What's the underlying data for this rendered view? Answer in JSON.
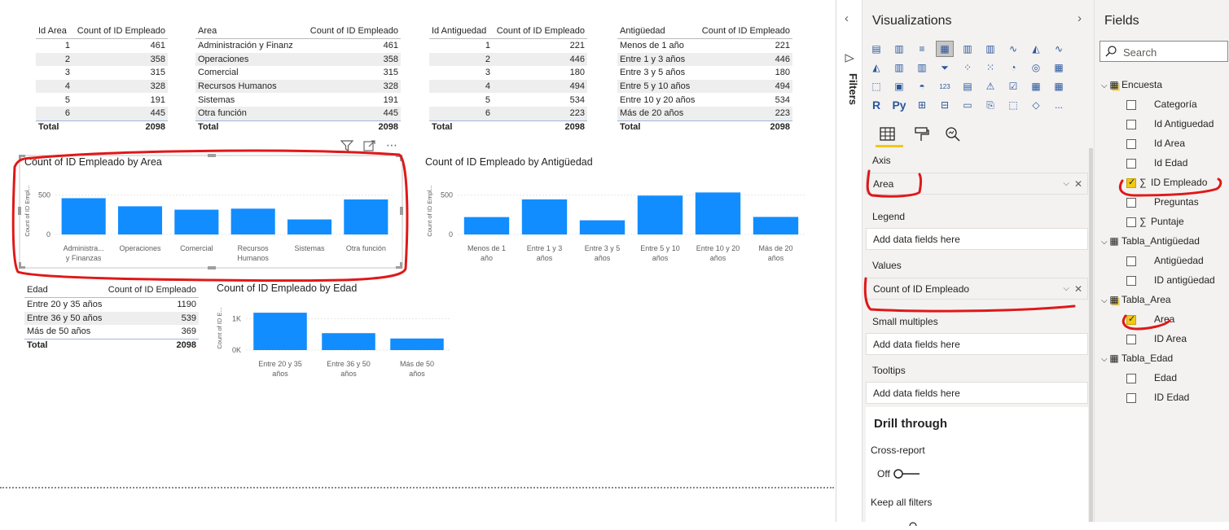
{
  "tables": {
    "area_id": {
      "headers": [
        "Id Area",
        "Count of ID Empleado"
      ],
      "rows": [
        [
          "1",
          "461"
        ],
        [
          "2",
          "358"
        ],
        [
          "3",
          "315"
        ],
        [
          "4",
          "328"
        ],
        [
          "5",
          "191"
        ],
        [
          "6",
          "445"
        ]
      ],
      "total": [
        "Total",
        "2098"
      ]
    },
    "area": {
      "headers": [
        "Area",
        "Count of ID Empleado"
      ],
      "rows": [
        [
          "Administración y Finanzas",
          "461"
        ],
        [
          "Operaciones",
          "358"
        ],
        [
          "Comercial",
          "315"
        ],
        [
          "Recursos Humanos",
          "328"
        ],
        [
          "Sistemas",
          "191"
        ],
        [
          "Otra función",
          "445"
        ]
      ],
      "total": [
        "Total",
        "2098"
      ]
    },
    "antig_id": {
      "headers": [
        "Id Antiguedad",
        "Count of ID Empleado"
      ],
      "rows": [
        [
          "1",
          "221"
        ],
        [
          "2",
          "446"
        ],
        [
          "3",
          "180"
        ],
        [
          "4",
          "494"
        ],
        [
          "5",
          "534"
        ],
        [
          "6",
          "223"
        ]
      ],
      "total": [
        "Total",
        "2098"
      ]
    },
    "antig": {
      "headers": [
        "Antigüedad",
        "Count of ID Empleado"
      ],
      "rows": [
        [
          "Menos de 1 año",
          "221"
        ],
        [
          "Entre 1 y 3 años",
          "446"
        ],
        [
          "Entre 3 y 5 años",
          "180"
        ],
        [
          "Entre 5 y 10 años",
          "494"
        ],
        [
          "Entre 10 y 20 años",
          "534"
        ],
        [
          "Más de 20 años",
          "223"
        ]
      ],
      "total": [
        "Total",
        "2098"
      ]
    },
    "edad": {
      "headers": [
        "Edad",
        "Count of ID Empleado"
      ],
      "rows": [
        [
          "Entre 20 y 35 años",
          "1190"
        ],
        [
          "Entre 36 y 50 años",
          "539"
        ],
        [
          "Más de 50 años",
          "369"
        ]
      ],
      "total": [
        "Total",
        "2098"
      ]
    }
  },
  "chart_data": [
    {
      "type": "bar",
      "title": "Count of ID Empleado by Area",
      "ylabel": "Count of ID Empl...",
      "yticks": [
        "500",
        "0"
      ],
      "ylim": [
        0,
        600
      ],
      "categories": [
        [
          "Administra...",
          "y Finanzas"
        ],
        [
          "Operaciones"
        ],
        [
          "Comercial"
        ],
        [
          "Recursos",
          "Humanos"
        ],
        [
          "Sistemas"
        ],
        [
          "Otra función"
        ]
      ],
      "values": [
        461,
        358,
        315,
        328,
        191,
        445
      ],
      "color": "#118dff"
    },
    {
      "type": "bar",
      "title": "Count of ID Empleado by Antigüedad",
      "ylabel": "Count of ID Empl...",
      "yticks": [
        "500",
        "0"
      ],
      "ylim": [
        0,
        600
      ],
      "categories": [
        [
          "Menos de 1",
          "año"
        ],
        [
          "Entre 1 y 3",
          "años"
        ],
        [
          "Entre 3 y 5",
          "años"
        ],
        [
          "Entre 5 y 10",
          "años"
        ],
        [
          "Entre 10 y 20",
          "años"
        ],
        [
          "Más de 20",
          "años"
        ]
      ],
      "values": [
        221,
        446,
        180,
        494,
        534,
        223
      ],
      "color": "#118dff"
    },
    {
      "type": "bar",
      "title": "Count of ID Empleado by Edad",
      "ylabel": "Count of ID E...",
      "yticks": [
        "1K",
        "0K"
      ],
      "ylim": [
        0,
        1400
      ],
      "categories": [
        [
          "Entre 20 y 35",
          "años"
        ],
        [
          "Entre 36 y 50",
          "años"
        ],
        [
          "Más de 50",
          "años"
        ]
      ],
      "values": [
        1190,
        539,
        369
      ],
      "color": "#118dff"
    }
  ],
  "filters_pane": {
    "label": "Filters"
  },
  "visualizations": {
    "title": "Visualizations",
    "wells": {
      "axis": {
        "label": "Axis",
        "value": "Area"
      },
      "legend": {
        "label": "Legend",
        "placeholder": "Add data fields here"
      },
      "values": {
        "label": "Values",
        "value": "Count of ID Empleado"
      },
      "small_multiples": {
        "label": "Small multiples",
        "placeholder": "Add data fields here"
      },
      "tooltips": {
        "label": "Tooltips",
        "placeholder": "Add data fields here"
      }
    },
    "drill_through": {
      "title": "Drill through",
      "cross_report": "Cross-report",
      "toggle": "Off",
      "keep_filters": "Keep all filters"
    },
    "more": "..."
  },
  "fields": {
    "title": "Fields",
    "search_placeholder": "Search",
    "tables": [
      {
        "name": "Encuesta",
        "items": [
          {
            "label": "Categoría",
            "checked": false,
            "sigma": false
          },
          {
            "label": "Id Antiguedad",
            "checked": false,
            "sigma": false
          },
          {
            "label": "Id Area",
            "checked": false,
            "sigma": false
          },
          {
            "label": "Id Edad",
            "checked": false,
            "sigma": false
          },
          {
            "label": "ID Empleado",
            "checked": true,
            "sigma": true
          },
          {
            "label": "Preguntas",
            "checked": false,
            "sigma": false
          },
          {
            "label": "Puntaje",
            "checked": false,
            "sigma": true
          }
        ]
      },
      {
        "name": "Tabla_Antigüedad",
        "items": [
          {
            "label": "Antigüedad",
            "checked": false,
            "sigma": false
          },
          {
            "label": "ID antigüedad",
            "checked": false,
            "sigma": false
          }
        ]
      },
      {
        "name": "Tabla_Area",
        "items": [
          {
            "label": "Area",
            "checked": true,
            "sigma": false
          },
          {
            "label": "ID Area",
            "checked": false,
            "sigma": false
          }
        ]
      },
      {
        "name": "Tabla_Edad",
        "items": [
          {
            "label": "Edad",
            "checked": false,
            "sigma": false
          },
          {
            "label": "ID Edad",
            "checked": false,
            "sigma": false
          }
        ]
      }
    ]
  }
}
